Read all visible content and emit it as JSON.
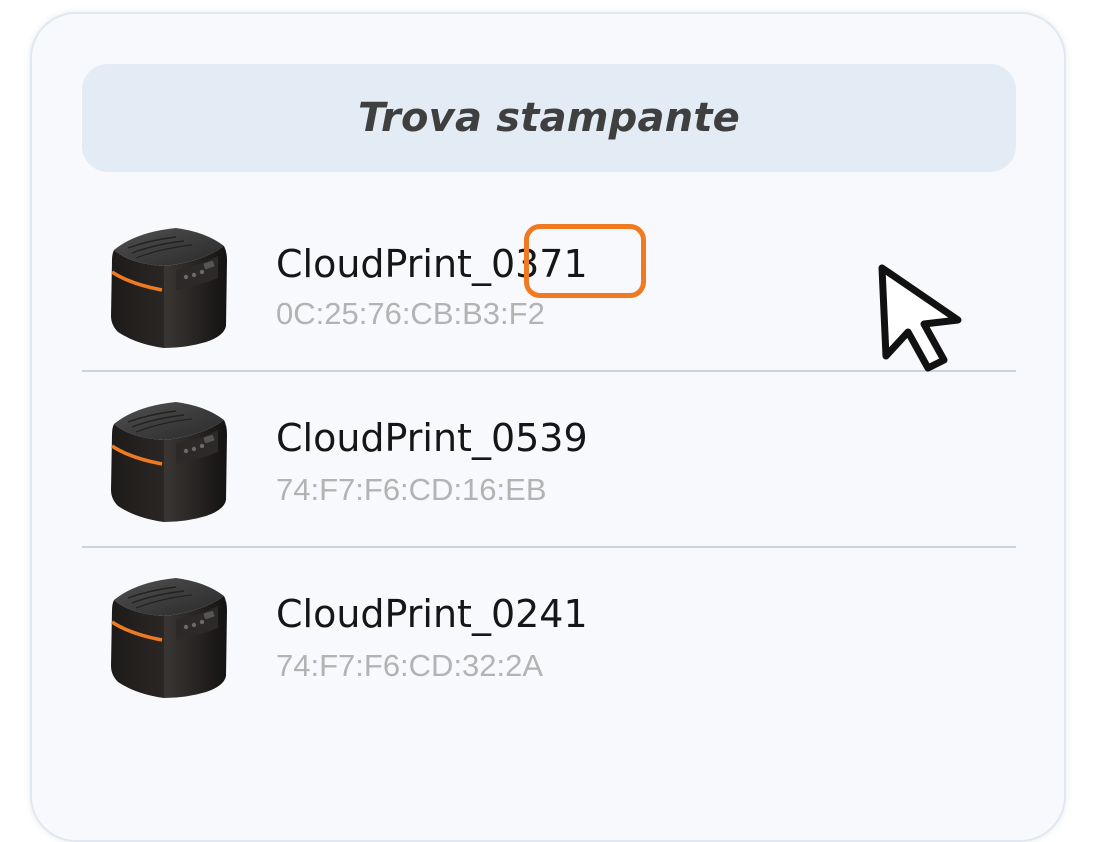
{
  "header": {
    "title": "Trova stampante"
  },
  "printers": [
    {
      "name": "CloudPrint_0371",
      "mac": "0C:25:76:CB:B3:F2"
    },
    {
      "name": "CloudPrint_0539",
      "mac": "74:F7:F6:CD:16:EB"
    },
    {
      "name": "CloudPrint_0241",
      "mac": "74:F7:F6:CD:32:2A"
    }
  ],
  "colors": {
    "highlight": "#f07a22",
    "printer_accent": "#f07a22",
    "header_background": "#e3ecf4",
    "divider": "#c7d5e1"
  },
  "icons": {
    "printer": "thermal-printer-icon",
    "cursor": "mouse-pointer-icon"
  }
}
